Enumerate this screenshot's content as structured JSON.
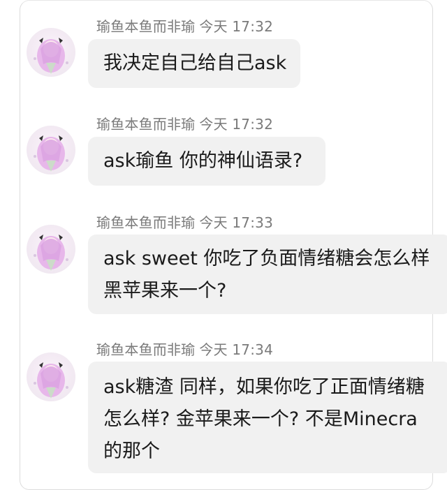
{
  "messages": [
    {
      "sender": "瑜鱼本鱼而非瑜",
      "time": "今天 17:32",
      "lines": [
        "我决定自己给自己ask"
      ]
    },
    {
      "sender": "瑜鱼本鱼而非瑜",
      "time": "今天 17:32",
      "lines": [
        "ask瑜鱼 你的神仙语录?"
      ]
    },
    {
      "sender": "瑜鱼本鱼而非瑜",
      "time": "今天 17:33",
      "lines": [
        "ask sweet 你吃了负面情绪糖会怎么样",
        "黑苹果来一个?"
      ]
    },
    {
      "sender": "瑜鱼本鱼而非瑜",
      "time": "今天 17:34",
      "lines": [
        "ask糖渣 同样，如果你吃了正面情绪糖",
        "怎么样? 金苹果来一个? 不是Minecra",
        "的那个"
      ]
    }
  ],
  "colors": {
    "bubble_bg": "#f1f1f1",
    "meta_text": "#7a7a7a",
    "message_text": "#1a1a1a"
  },
  "icons": {
    "avatar": "anime-girl-avatar-icon"
  }
}
